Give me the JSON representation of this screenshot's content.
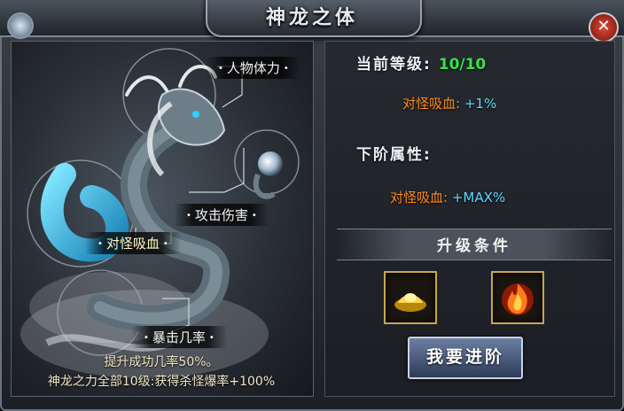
{
  "window": {
    "title": "神龙之体",
    "close_label": "✕"
  },
  "attributes": [
    {
      "id": "hp",
      "label": "人物体力"
    },
    {
      "id": "atk",
      "label": "攻击伤害"
    },
    {
      "id": "lifesteal",
      "label": "对怪吸血",
      "selected": true
    },
    {
      "id": "crit",
      "label": "暴击几率"
    }
  ],
  "footer": {
    "line1": "提升成功几率50%。",
    "line2": "神龙之力全部10级:获得杀怪爆率+100%"
  },
  "current": {
    "level_label": "当前等级:",
    "level_value": "10/10",
    "attr_name": "对怪吸血:",
    "attr_value": "+1%"
  },
  "next": {
    "label": "下阶属性:",
    "attr_name": "对怪吸血:",
    "attr_value": "+MAX%"
  },
  "upgrade": {
    "title": "升级条件",
    "items": [
      {
        "icon": "gold-ingot-icon"
      },
      {
        "icon": "fire-orb-icon"
      }
    ],
    "button_label": "我要进阶"
  },
  "colors": {
    "level_green": "#36e24a",
    "attr_orange": "#ff8a1e",
    "value_cyan": "#5ed6ff",
    "slot_gold": "#c9a64a"
  }
}
